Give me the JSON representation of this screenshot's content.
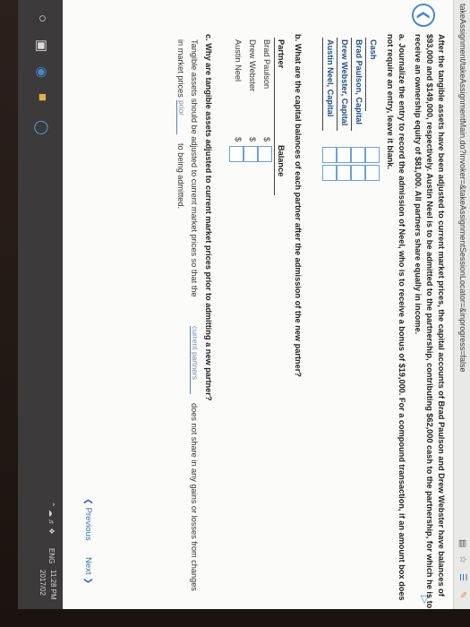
{
  "browser": {
    "url": "takeAssignment/takeAssignmentMain.do?invoker=&takeAssignmentSessionLocator=&inprogress=false"
  },
  "question": {
    "intro_line1": "After the tangible assets have been adjusted to current market prices, the capital accounts of Brad Paulson and Drew Webster have balances of",
    "intro_line2": "$93,000 and $149,000, respectively. Austin Neel is to be admitted to the partnership, contributing $62,000 cash to the partnership, for which he is to",
    "intro_line3": "receive an ownership equity of $81,000. All partners share equally in income.",
    "part_a_line1": "a.  Journalize the entry to record the admission of Neel, who is to receive a bonus of $19,000. For a compound transaction, if an amount box does",
    "part_a_line2": "not require an entry, leave it blank.",
    "journal_accounts": [
      "Cash",
      "Brad Paulson, Capital",
      "Drew Webster, Capital",
      "Austin Neel, Capital"
    ],
    "part_b": "b.  What are the capital balances of each partner after the admission of the new partner?",
    "balance_header": "Balance",
    "partner_header": "Partner",
    "partners": [
      "Brad Paulson",
      "Drew Webster",
      "Austin Neel"
    ],
    "currency_symbol": "$",
    "part_c": "c.  Why are tangible assets adjusted to current market prices prior to admitting a new partner?",
    "part_c_answer_pre": "Tangible assets should be adjusted to current market prices so that the",
    "part_c_dropdown1": "current partners",
    "part_c_answer_mid": "does not share in any gains or losses from changes",
    "part_c_answer_line2": "in market prices",
    "part_c_dropdown2": "prior",
    "part_c_answer_end": "to being admitted."
  },
  "nav": {
    "previous": "Previous",
    "next": "Next"
  },
  "taskbar": {
    "lang": "ENG",
    "time": "11:28 PM",
    "date": "2017/02"
  }
}
